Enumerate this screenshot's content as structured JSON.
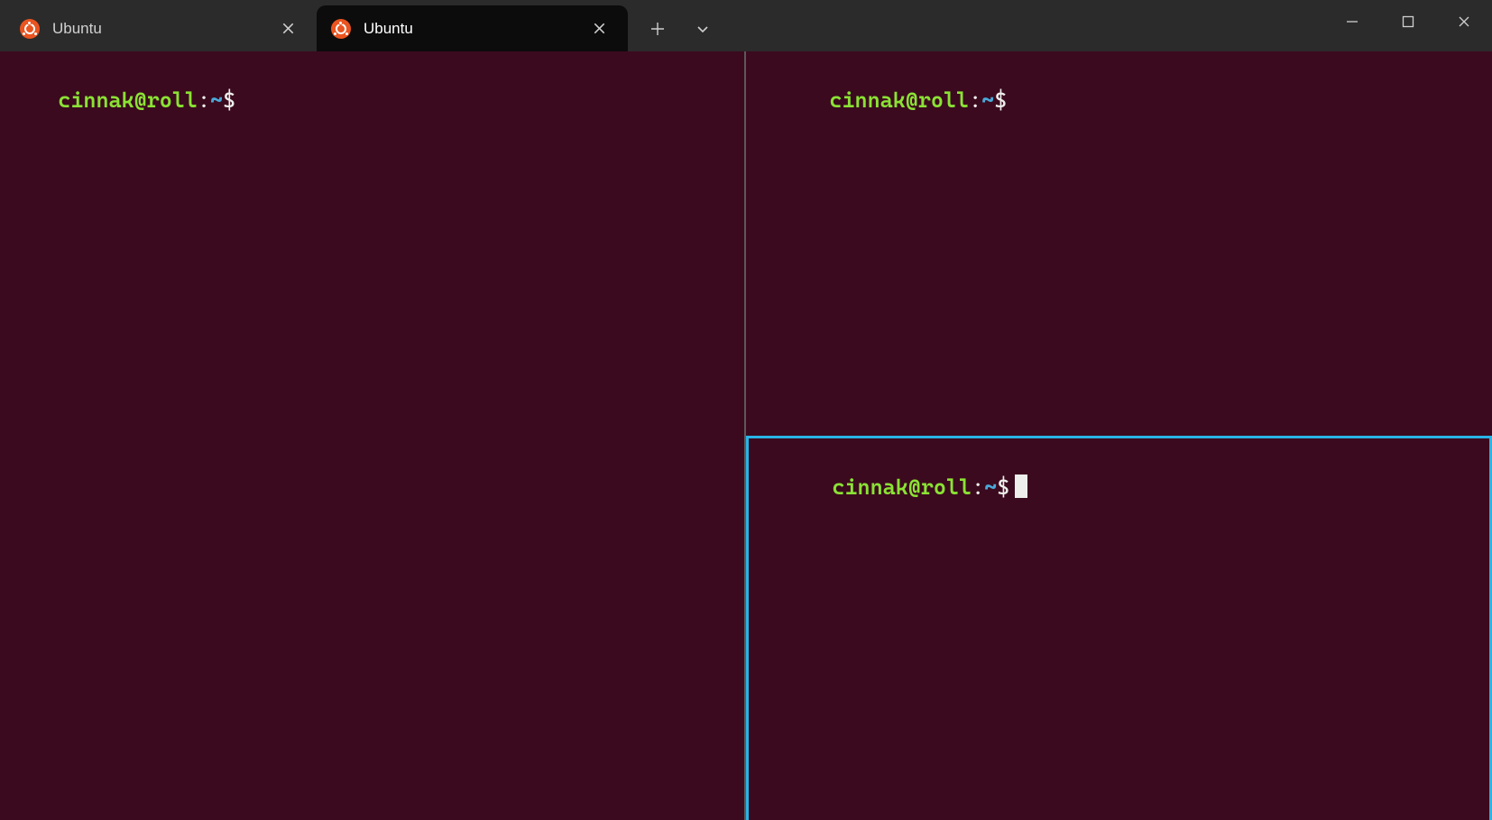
{
  "titlebar": {
    "tabs": [
      {
        "label": "Ubuntu",
        "active": false
      },
      {
        "label": "Ubuntu",
        "active": true
      }
    ]
  },
  "panes": {
    "left": {
      "prompt": {
        "userhost": "cinnak@roll",
        "sep": ":",
        "path": "~",
        "sigil": "$"
      },
      "focused": false
    },
    "top_right": {
      "prompt": {
        "userhost": "cinnak@roll",
        "sep": ":",
        "path": "~",
        "sigil": "$"
      },
      "focused": false
    },
    "bottom_right": {
      "prompt": {
        "userhost": "cinnak@roll",
        "sep": ":",
        "path": "~",
        "sigil": "$"
      },
      "focused": true
    }
  },
  "colors": {
    "terminal_bg": "#3b0a1e",
    "accent_focus": "#29b3e6",
    "prompt_user": "#8ae234",
    "prompt_path": "#4aa8d8",
    "ubuntu_orange": "#e95420"
  }
}
